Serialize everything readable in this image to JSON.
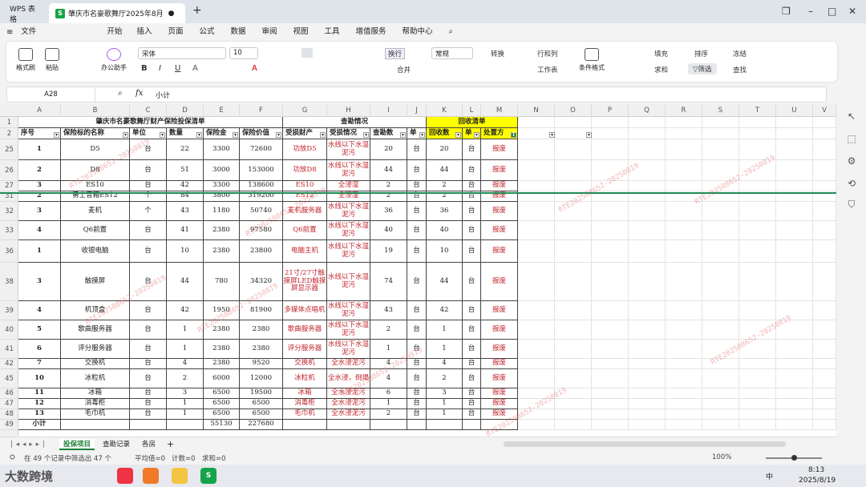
{
  "tabs": {
    "app": "WPS 表格",
    "doc": "肇庆市名豪歌舞厅2025年8月"
  },
  "menu": [
    "文件",
    "开始",
    "插入",
    "页面",
    "公式",
    "数据",
    "审阅",
    "视图",
    "工具",
    "增值服务",
    "帮助中心"
  ],
  "ribbon": {
    "format_painter": "格式刷",
    "paste": "粘贴",
    "ai": "办公助手",
    "font": "宋体",
    "size": "10",
    "wrap": "换行",
    "num_format": "常规",
    "convert": "转换",
    "row_col": "行和列",
    "worksheet": "工作表",
    "cond_format": "条件格式",
    "fill": "填充",
    "sort": "排序",
    "freeze": "冻结",
    "sum": "求和",
    "filter": "筛选",
    "find": "查找",
    "merge": "合并"
  },
  "formula": {
    "ref": "A28",
    "value": "小计"
  },
  "cols": [
    "A",
    "B",
    "C",
    "D",
    "E",
    "F",
    "G",
    "H",
    "I",
    "J",
    "K",
    "L",
    "M",
    "N",
    "O",
    "P",
    "Q",
    "R",
    "S",
    "T",
    "U",
    "V"
  ],
  "title": "肇庆市名豪歌舞厅财产保险投保清单",
  "survey": "查勘情况",
  "recovery": "回收清单",
  "headers": [
    "序号",
    "保险标的名称",
    "单位",
    "数量",
    "保险金",
    "保险价值",
    "受损财产",
    "受损情况",
    "查勘数",
    "单",
    "回收数",
    "单",
    "处置方"
  ],
  "rows": [
    {
      "r": "25",
      "c": [
        "1",
        "D5",
        "台",
        "22",
        "3300",
        "72600",
        "功放D5",
        "水线以下水湿泥污",
        "20",
        "台",
        "20",
        "台",
        "报废"
      ]
    },
    {
      "r": "26",
      "c": [
        "2",
        "D8",
        "台",
        "51",
        "3000",
        "153000",
        "功放D8",
        "水线以下水湿泥污",
        "44",
        "台",
        "44",
        "台",
        "报废"
      ]
    },
    {
      "r": "27",
      "c": [
        "3",
        "ES10",
        "台",
        "42",
        "3300",
        "138600",
        "ES10",
        "全浸湿",
        "2",
        "台",
        "2",
        "台",
        "报废"
      ]
    },
    {
      "r": "31",
      "c": [
        "2",
        "勇士音箱ES12",
        "个",
        "84",
        "3800",
        "319200",
        "ES12",
        "全浸湿",
        "2",
        "台",
        "2",
        "台",
        "报废"
      ]
    },
    {
      "r": "32",
      "c": [
        "3",
        "麦机",
        "个",
        "43",
        "1180",
        "50740",
        "麦机服务器",
        "水线以下水湿泥污",
        "36",
        "台",
        "36",
        "台",
        "报废"
      ]
    },
    {
      "r": "33",
      "c": [
        "4",
        "Q6前置",
        "台",
        "41",
        "2380",
        "97580",
        "Q6前置",
        "水线以下水湿泥污",
        "40",
        "台",
        "40",
        "台",
        "报废"
      ]
    },
    {
      "r": "36",
      "c": [
        "1",
        "收银电脑",
        "台",
        "10",
        "2380",
        "23800",
        "电脑主机",
        "水线以下水湿泥污",
        "19",
        "台",
        "10",
        "台",
        "报废"
      ]
    },
    {
      "r": "38",
      "c": [
        "3",
        "触摸屏",
        "台",
        "44",
        "780",
        "34320",
        "21寸/27寸触摸屏LED触摸屏显示器",
        "水线以下水湿泥污",
        "74",
        "台",
        "44",
        "台",
        "报废"
      ]
    },
    {
      "r": "39",
      "c": [
        "4",
        "机顶盒",
        "台",
        "42",
        "1950",
        "81900",
        "多媒体点唱机",
        "水线以下水湿泥污",
        "43",
        "台",
        "42",
        "台",
        "报废"
      ]
    },
    {
      "r": "40",
      "c": [
        "5",
        "歌曲服务器",
        "台",
        "1",
        "2380",
        "2380",
        "歌曲服务器",
        "水线以下水湿泥污",
        "2",
        "台",
        "1",
        "台",
        "报废"
      ]
    },
    {
      "r": "41",
      "c": [
        "6",
        "评分服务器",
        "台",
        "1",
        "2380",
        "2380",
        "评分服务器",
        "水线以下水湿泥污",
        "1",
        "台",
        "1",
        "台",
        "报废"
      ]
    },
    {
      "r": "42",
      "c": [
        "7",
        "交换机",
        "台",
        "4",
        "2380",
        "9520",
        "交换机",
        "全水浸泥污",
        "4",
        "台",
        "4",
        "台",
        "报废"
      ]
    },
    {
      "r": "45",
      "c": [
        "10",
        "冰粒机",
        "台",
        "2",
        "6000",
        "12000",
        "冰粒机",
        "全水浸，倒塌",
        "4",
        "台",
        "2",
        "台",
        "报废"
      ]
    },
    {
      "r": "46",
      "c": [
        "11",
        "冰箱",
        "台",
        "3",
        "6500",
        "19500",
        "冰箱",
        "全水浸泥污",
        "6",
        "台",
        "3",
        "台",
        "报废"
      ]
    },
    {
      "r": "47",
      "c": [
        "12",
        "消毒柜",
        "台",
        "1",
        "6500",
        "6500",
        "消毒柜",
        "全水浸泥污",
        "1",
        "台",
        "1",
        "台",
        "报废"
      ]
    },
    {
      "r": "48",
      "c": [
        "13",
        "毛巾机",
        "台",
        "1",
        "6500",
        "6500",
        "毛巾机",
        "全水浸泥污",
        "2",
        "台",
        "1",
        "台",
        "报废"
      ]
    },
    {
      "r": "49",
      "c": [
        "小计",
        "",
        "",
        "",
        "55130",
        "227680",
        "",
        "",
        "",
        "",
        "",
        "",
        ""
      ]
    }
  ],
  "watermark": "RTE202508652-20250819",
  "sheets": [
    "投保项目",
    "查勘记录",
    "各房"
  ],
  "status": {
    "records": "在 49 个记录中筛选出 47 个",
    "avg": "平均值=0",
    "count": "计数=0",
    "sum": "求和=0",
    "zoom": "100%"
  },
  "taskbar": {
    "time": "8:13",
    "date": "2025/8/19",
    "lang": "中",
    "brand": "大数跨境"
  }
}
